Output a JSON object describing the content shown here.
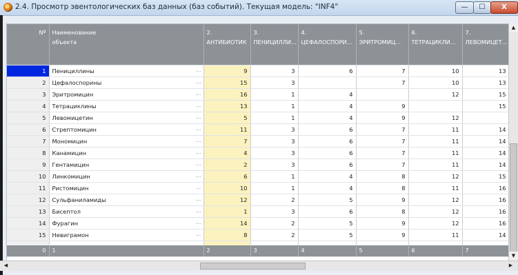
{
  "window": {
    "title": "2.4. Просмотр эвентологических баз данных (баз событий). Текущая модель: \"INF4\"",
    "minimize_label": "—",
    "maximize_label": "☐",
    "close_label": "X"
  },
  "table": {
    "headers": [
      {
        "top": "Nº",
        "sub": ""
      },
      {
        "top": "Наименование",
        "sub": "объекта"
      },
      {
        "top": "2.",
        "sub": "АНТИБИОТИК"
      },
      {
        "top": "3.",
        "sub": "ПЕНИЦИЛЛИ..."
      },
      {
        "top": "4.",
        "sub": "ЦЕФАЛОСПОРИ..."
      },
      {
        "top": "5.",
        "sub": "ЭРИТРОМИЦ..."
      },
      {
        "top": "6.",
        "sub": "ТЕТРАЦИКЛИ..."
      },
      {
        "top": "7.",
        "sub": "ЛЕВОМИЦЕТ..."
      }
    ],
    "ellipsis": "...",
    "rows": [
      {
        "n": "1",
        "name": "Пенициллины",
        "c": [
          "9",
          "3",
          "6",
          "7",
          "10",
          "13"
        ]
      },
      {
        "n": "2",
        "name": "Цефалоспорины",
        "c": [
          "15",
          "3",
          "",
          "7",
          "10",
          "13"
        ]
      },
      {
        "n": "3",
        "name": "Эритромицин",
        "c": [
          "16",
          "1",
          "4",
          "",
          "12",
          "15"
        ]
      },
      {
        "n": "4",
        "name": "Тетрациклины",
        "c": [
          "13",
          "1",
          "4",
          "9",
          "",
          "15"
        ]
      },
      {
        "n": "5",
        "name": "Левомицетин",
        "c": [
          "5",
          "1",
          "4",
          "9",
          "12",
          ""
        ]
      },
      {
        "n": "6",
        "name": "Стрептомицин",
        "c": [
          "11",
          "3",
          "6",
          "7",
          "11",
          "14"
        ]
      },
      {
        "n": "7",
        "name": "Мономицин",
        "c": [
          "7",
          "3",
          "6",
          "7",
          "11",
          "14"
        ]
      },
      {
        "n": "8",
        "name": "Канамицин",
        "c": [
          "4",
          "3",
          "6",
          "7",
          "11",
          "14"
        ]
      },
      {
        "n": "9",
        "name": "Гентамицин",
        "c": [
          "2",
          "3",
          "6",
          "7",
          "11",
          "14"
        ]
      },
      {
        "n": "10",
        "name": "Линкомицин",
        "c": [
          "6",
          "1",
          "4",
          "8",
          "12",
          "15"
        ]
      },
      {
        "n": "11",
        "name": "Ристомицин",
        "c": [
          "10",
          "1",
          "4",
          "8",
          "11",
          "16"
        ]
      },
      {
        "n": "12",
        "name": "Сульфаниламиды",
        "c": [
          "12",
          "2",
          "5",
          "9",
          "12",
          "16"
        ]
      },
      {
        "n": "13",
        "name": "Бисептол",
        "c": [
          "1",
          "3",
          "6",
          "8",
          "12",
          "16"
        ]
      },
      {
        "n": "14",
        "name": "Фурагин",
        "c": [
          "14",
          "2",
          "5",
          "9",
          "12",
          "16"
        ]
      },
      {
        "n": "15",
        "name": "Невиграмон",
        "c": [
          "8",
          "2",
          "5",
          "9",
          "11",
          "14"
        ]
      }
    ],
    "footer": [
      "0",
      "1",
      "2",
      "3",
      "4",
      "5",
      "6",
      "7"
    ]
  },
  "colors": {
    "header_bg": "#8c9296",
    "highlight_column": "#fcf2bf",
    "selected_row_number": "#0027e0"
  }
}
